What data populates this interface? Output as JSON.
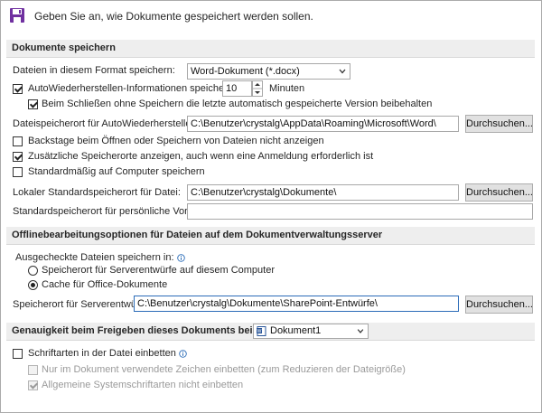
{
  "header": {
    "icon": "floppy-disk-icon",
    "text": "Geben Sie an, wie Dokumente gespeichert werden sollen."
  },
  "sections": {
    "save": "Dokumente speichern",
    "offline": "Offlinebearbeitungsoptionen für Dateien auf dem Dokumentverwaltungsserver",
    "fidelity": "Genauigkeit beim Freigeben dieses Dokuments beibehalten:"
  },
  "save": {
    "format_label": "Dateien in diesem Format speichern:",
    "format_value": "Word-Dokument (*.docx)",
    "autorecover_label": "AutoWiederherstellen-Informationen speichern alle",
    "autorecover_checked": true,
    "autorecover_minutes": "10",
    "minutes_label": "Minuten",
    "keep_last_label": "Beim Schließen ohne Speichern die letzte automatisch gespeicherte Version beibehalten",
    "keep_last_checked": true,
    "autorecover_path_label": "Dateispeicherort für AutoWiederherstellen:",
    "autorecover_path": "C:\\Benutzer\\crystalg\\AppData\\Roaming\\Microsoft\\Word\\",
    "browse_label": "Durchsuchen...",
    "no_backstage_label": "Backstage beim Öffnen oder Speichern von Dateien nicht anzeigen",
    "no_backstage_checked": false,
    "show_locations_label": "Zusätzliche Speicherorte anzeigen, auch wenn eine Anmeldung erforderlich ist",
    "show_locations_checked": true,
    "default_computer_label": "Standardmäßig auf Computer speichern",
    "default_computer_checked": false,
    "local_path_label": "Lokaler Standardspeicherort für Datei:",
    "local_path": "C:\\Benutzer\\crystalg\\Dokumente\\",
    "templates_label": "Standardspeicherort für persönliche Vorlagen:",
    "templates_path": ""
  },
  "offline": {
    "checkout_label": "Ausgecheckte Dateien speichern in:",
    "option_server": "Speicherort für Serverentwürfe auf diesem Computer",
    "option_server_selected": false,
    "option_cache": "Cache für Office-Dokumente",
    "option_cache_selected": true,
    "drafts_label": "Speicherort für Serverentwürfe:",
    "drafts_path": "C:\\Benutzer\\crystalg\\Dokumente\\SharePoint-Entwürfe\\",
    "browse_label": "Durchsuchen..."
  },
  "fidelity": {
    "document_value": "Dokument1",
    "embed_fonts_label": "Schriftarten in der Datei einbetten",
    "embed_fonts_checked": false,
    "only_used_label": "Nur im Dokument verwendete Zeichen einbetten (zum Reduzieren der Dateigröße)",
    "only_used_checked": false,
    "no_system_label": "Allgemeine Systemschriftarten nicht einbetten",
    "no_system_checked": true
  },
  "colors": {
    "accent": "#7030a0",
    "section_bg": "#eeeeee",
    "focus": "#2b6cb8"
  }
}
